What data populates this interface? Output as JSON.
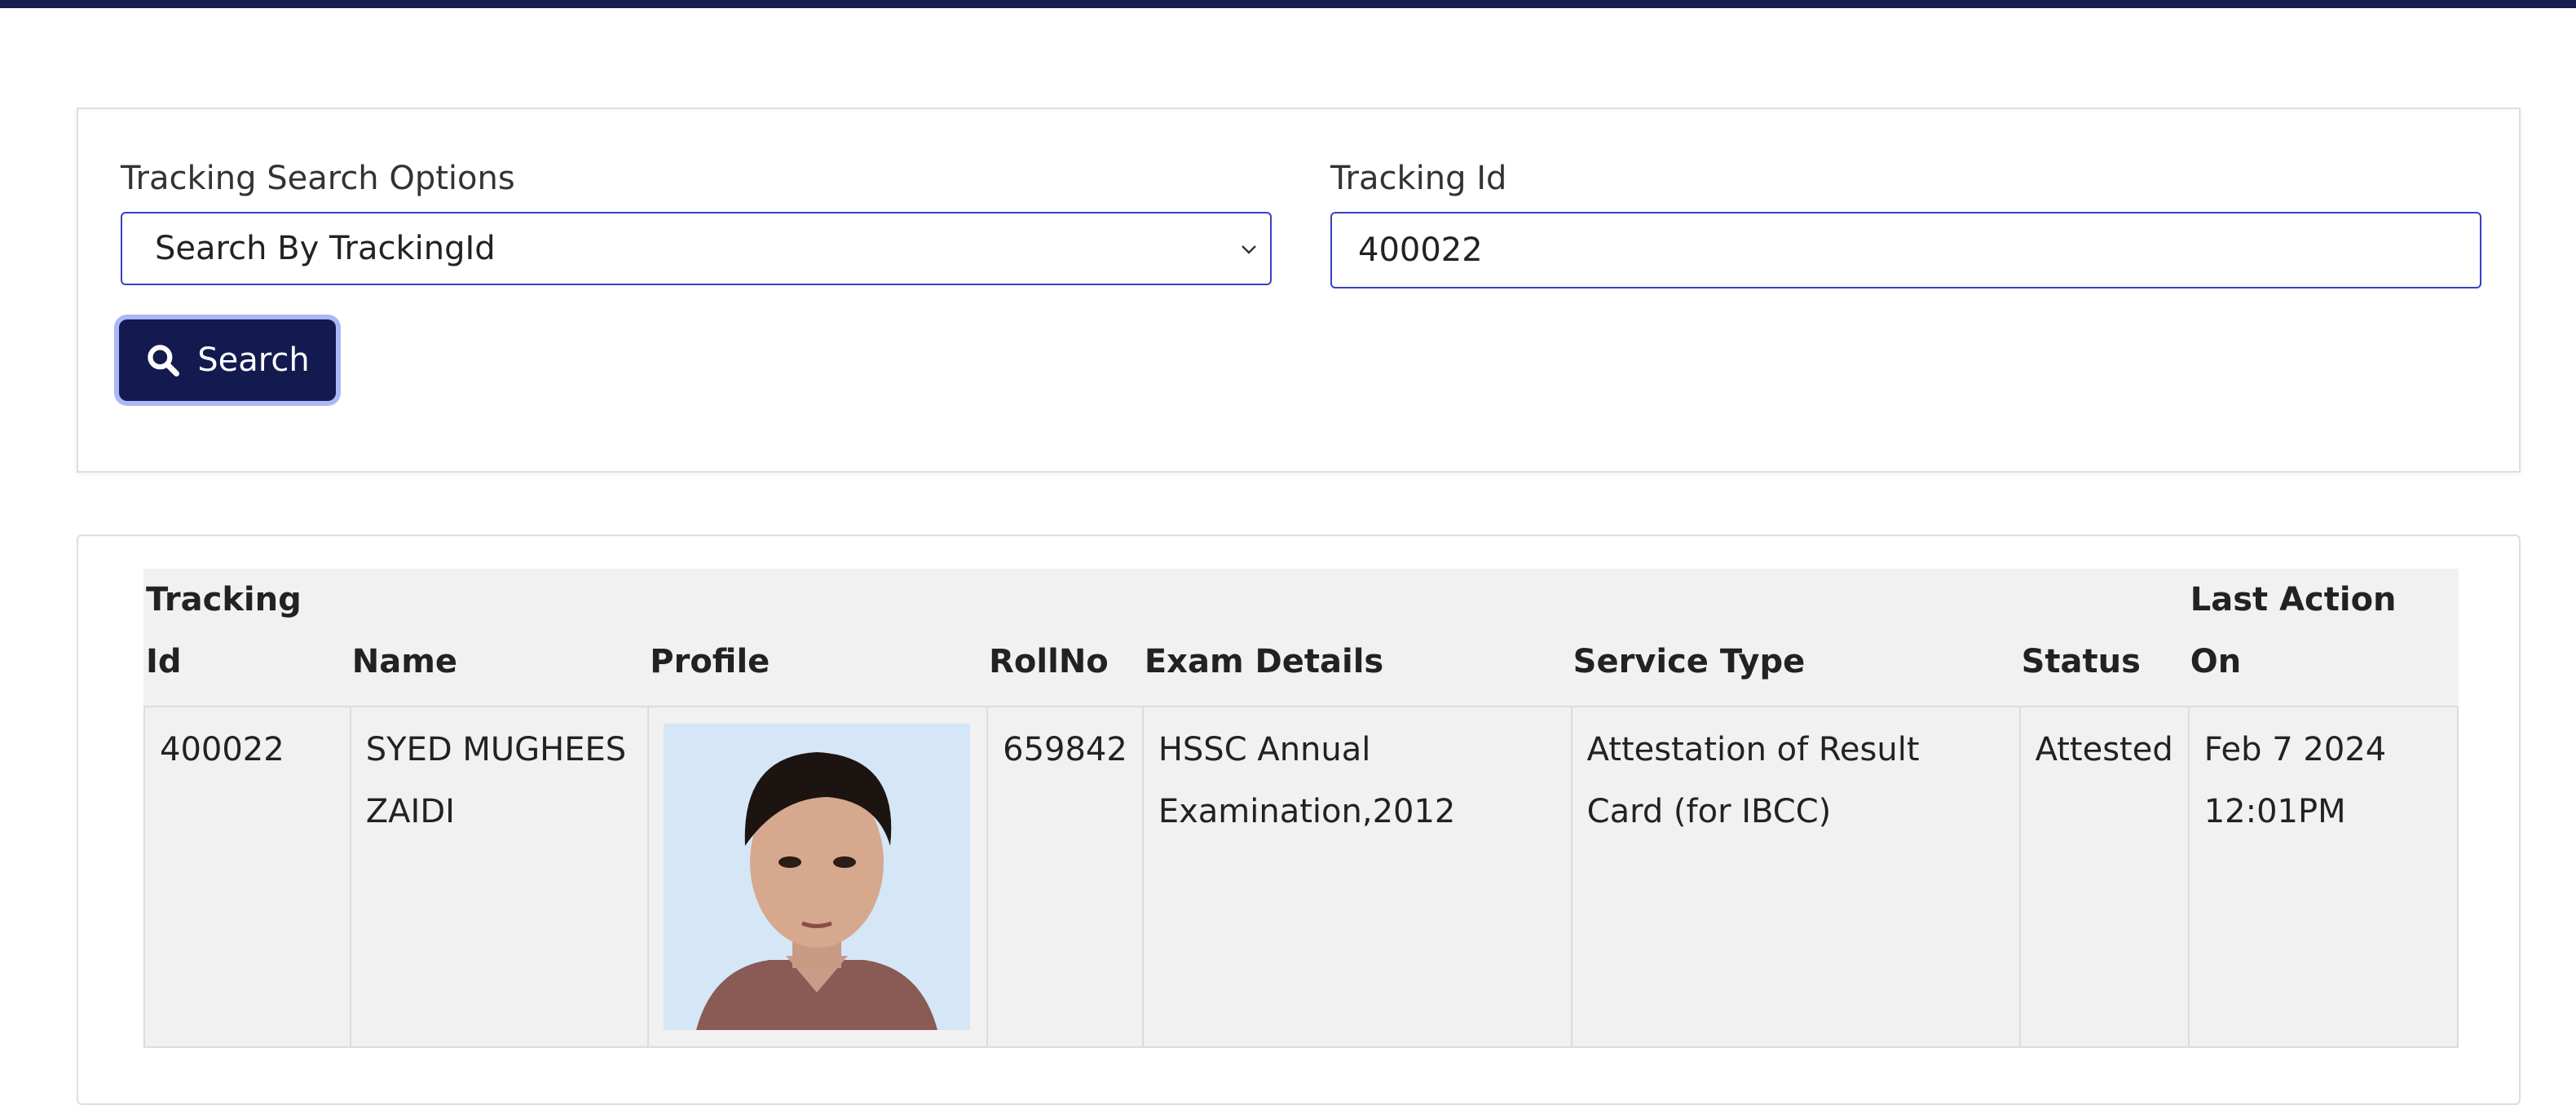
{
  "search": {
    "options_label": "Tracking Search Options",
    "selected_option": "Search By TrackingId",
    "tracking_label": "Tracking Id",
    "tracking_value": "400022",
    "button_label": "Search"
  },
  "results": {
    "headers": [
      "Tracking Id",
      "Name",
      "Profile",
      "RollNo",
      "Exam Details",
      "Service Type",
      "Status",
      "Last Action On"
    ],
    "rows": [
      {
        "tracking_id": "400022",
        "name": "SYED MUGHEES ZAIDI",
        "rollno": "659842",
        "exam_details": "HSSC Annual Examination,2012",
        "service_type": "Attestation of Result Card (for IBCC)",
        "status": "Attested",
        "last_action_on": "Feb 7 2024 12:01PM"
      }
    ]
  },
  "icons": {
    "search_button": "search-icon",
    "select_arrow": "chevron-down-icon"
  },
  "colors": {
    "accent": "#141c50",
    "focus": "#3a40c8",
    "focus_ring": "#a9b8f7"
  }
}
